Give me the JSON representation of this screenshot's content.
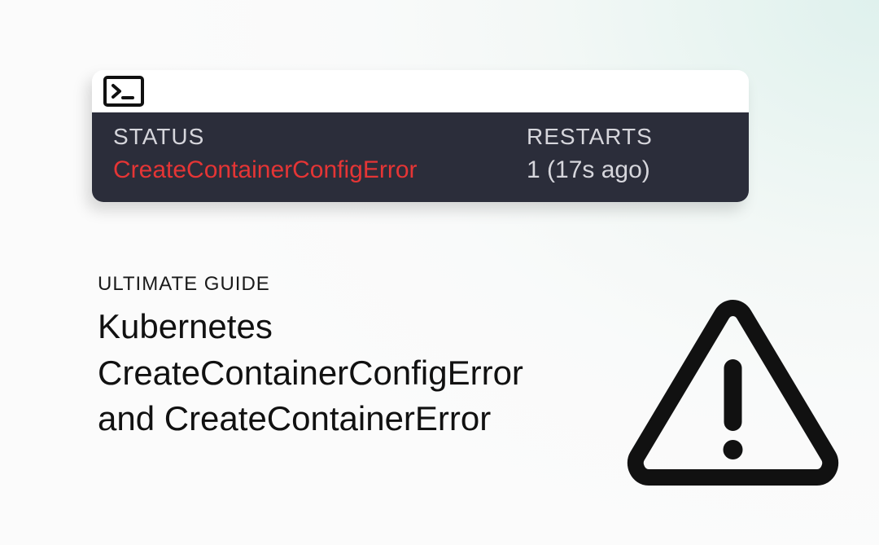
{
  "terminal": {
    "status_label": "STATUS",
    "status_value": "CreateContainerConfigError",
    "restarts_label": "RESTARTS",
    "restarts_value": "1 (17s ago)"
  },
  "text": {
    "eyebrow": "ULTIMATE GUIDE",
    "headline_line1": "Kubernetes",
    "headline_line2": "CreateContainerConfigError",
    "headline_line3": "and CreateContainerError"
  },
  "icons": {
    "shell": "terminal-icon",
    "warning": "warning-triangle-icon"
  }
}
